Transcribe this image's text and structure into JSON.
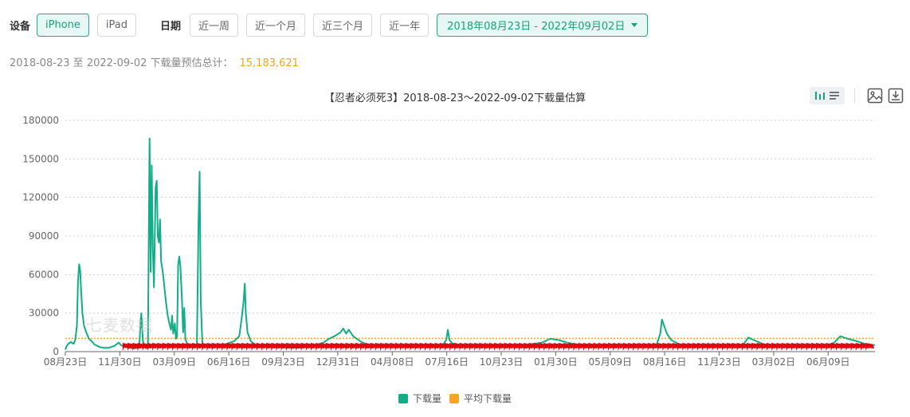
{
  "filters": {
    "device_label": "设备",
    "devices": [
      "iPhone",
      "iPad"
    ],
    "active_device": "iPhone",
    "date_label": "日期",
    "quick_ranges": [
      "近一周",
      "近一个月",
      "近三个月",
      "近一年"
    ],
    "date_range": "2018年08月23日 - 2022年09月02日"
  },
  "summary": {
    "text": "2018-08-23 至 2022-09-02 下载量预估总计：",
    "total": "15,183,621"
  },
  "watermark": "七麦数据",
  "colors": {
    "accent": "#16b08c",
    "series": "#12ad87",
    "average": "#f5a623",
    "marker": "#e8000b",
    "total": "#f5a623"
  },
  "toolbar": {
    "icons": [
      "bar-chart-icon",
      "list-icon",
      "image-export-icon",
      "download-icon"
    ]
  },
  "chart_data": {
    "type": "line",
    "title": "【忍者必须死3】2018-08-23～2022-09-02下载量估算",
    "xlabel": "",
    "ylabel": "",
    "ylim": [
      0,
      180000
    ],
    "yticks": [
      0,
      30000,
      60000,
      90000,
      120000,
      150000,
      180000
    ],
    "ytick_labels": [
      "0",
      "30000",
      "60000",
      "90000",
      "120000",
      "150000",
      "180000"
    ],
    "x_range": [
      "2018-08-23",
      "2022-09-02"
    ],
    "xtick_dates": [
      "2018-08-23",
      "2018-11-30",
      "2019-03-09",
      "2019-06-16",
      "2019-09-23",
      "2019-12-31",
      "2020-04-08",
      "2020-07-16",
      "2020-10-23",
      "2021-01-30",
      "2021-05-09",
      "2021-08-16",
      "2021-11-23",
      "2022-03-02",
      "2022-06-09"
    ],
    "xtick_labels": [
      "08月23日",
      "11月30日",
      "03月09日",
      "06月16日",
      "09月23日",
      "12月31日",
      "04月08日",
      "07月16日",
      "10月23日",
      "01月30日",
      "05月09日",
      "08月16日",
      "11月23日",
      "03月02日",
      "06月09日"
    ],
    "grid": true,
    "legend_position": "bottom",
    "series": [
      {
        "name": "下载量",
        "points": [
          [
            "2018-08-23",
            1500
          ],
          [
            "2018-08-25",
            4000
          ],
          [
            "2018-08-28",
            6000
          ],
          [
            "2018-09-02",
            7500
          ],
          [
            "2018-09-07",
            6000
          ],
          [
            "2018-09-10",
            9000
          ],
          [
            "2018-09-13",
            20000
          ],
          [
            "2018-09-15",
            55000
          ],
          [
            "2018-09-17",
            68000
          ],
          [
            "2018-09-19",
            63000
          ],
          [
            "2018-09-21",
            45000
          ],
          [
            "2018-09-23",
            30000
          ],
          [
            "2018-09-26",
            20000
          ],
          [
            "2018-09-30",
            15000
          ],
          [
            "2018-10-05",
            10000
          ],
          [
            "2018-10-10",
            8000
          ],
          [
            "2018-10-15",
            5500
          ],
          [
            "2018-10-20",
            4500
          ],
          [
            "2018-10-25",
            3500
          ],
          [
            "2018-11-01",
            3000
          ],
          [
            "2018-11-10",
            3000
          ],
          [
            "2018-11-20",
            4500
          ],
          [
            "2018-11-28",
            7000
          ],
          [
            "2018-12-02",
            5000
          ],
          [
            "2018-12-10",
            3500
          ],
          [
            "2018-12-18",
            3000
          ],
          [
            "2018-12-26",
            2500
          ],
          [
            "2019-01-04",
            3000
          ],
          [
            "2019-01-08",
            30000
          ],
          [
            "2019-01-11",
            8000
          ],
          [
            "2019-01-14",
            4000
          ],
          [
            "2019-01-17",
            2500
          ],
          [
            "2019-01-20",
            4000
          ],
          [
            "2019-01-23",
            166000
          ],
          [
            "2019-01-25",
            62000
          ],
          [
            "2019-01-27",
            145000
          ],
          [
            "2019-01-29",
            80000
          ],
          [
            "2019-01-31",
            50000
          ],
          [
            "2019-02-03",
            128000
          ],
          [
            "2019-02-05",
            133000
          ],
          [
            "2019-02-07",
            90000
          ],
          [
            "2019-02-09",
            85000
          ],
          [
            "2019-02-11",
            103000
          ],
          [
            "2019-02-13",
            70000
          ],
          [
            "2019-02-16",
            62000
          ],
          [
            "2019-02-19",
            50000
          ],
          [
            "2019-02-22",
            38000
          ],
          [
            "2019-02-25",
            28000
          ],
          [
            "2019-02-28",
            22000
          ],
          [
            "2019-03-03",
            17000
          ],
          [
            "2019-03-05",
            28000
          ],
          [
            "2019-03-07",
            14000
          ],
          [
            "2019-03-10",
            22000
          ],
          [
            "2019-03-12",
            10000
          ],
          [
            "2019-03-14",
            12000
          ],
          [
            "2019-03-16",
            68000
          ],
          [
            "2019-03-18",
            74000
          ],
          [
            "2019-03-20",
            66000
          ],
          [
            "2019-03-23",
            40000
          ],
          [
            "2019-03-25",
            15000
          ],
          [
            "2019-03-27",
            34000
          ],
          [
            "2019-03-29",
            10000
          ],
          [
            "2019-04-02",
            5000
          ],
          [
            "2019-04-08",
            4000
          ],
          [
            "2019-04-14",
            3500
          ],
          [
            "2019-04-19",
            5000
          ],
          [
            "2019-04-22",
            100000
          ],
          [
            "2019-04-24",
            140000
          ],
          [
            "2019-04-26",
            40000
          ],
          [
            "2019-04-29",
            6000
          ],
          [
            "2019-05-05",
            4000
          ],
          [
            "2019-05-15",
            3500
          ],
          [
            "2019-05-25",
            4500
          ],
          [
            "2019-06-05",
            5000
          ],
          [
            "2019-06-15",
            6500
          ],
          [
            "2019-06-25",
            8000
          ],
          [
            "2019-07-05",
            12000
          ],
          [
            "2019-07-10",
            28000
          ],
          [
            "2019-07-13",
            40000
          ],
          [
            "2019-07-15",
            53000
          ],
          [
            "2019-07-17",
            30000
          ],
          [
            "2019-07-20",
            15000
          ],
          [
            "2019-07-26",
            8000
          ],
          [
            "2019-08-05",
            5000
          ],
          [
            "2019-08-20",
            4000
          ],
          [
            "2019-09-05",
            3500
          ],
          [
            "2019-09-20",
            3500
          ],
          [
            "2019-10-05",
            3000
          ],
          [
            "2019-10-20",
            3000
          ],
          [
            "2019-11-05",
            4000
          ],
          [
            "2019-11-20",
            5000
          ],
          [
            "2019-12-05",
            7000
          ],
          [
            "2019-12-15",
            10000
          ],
          [
            "2019-12-25",
            12000
          ],
          [
            "2020-01-05",
            15000
          ],
          [
            "2020-01-10",
            18000
          ],
          [
            "2020-01-15",
            14000
          ],
          [
            "2020-01-20",
            17000
          ],
          [
            "2020-01-28",
            12000
          ],
          [
            "2020-02-10",
            8000
          ],
          [
            "2020-02-25",
            5000
          ],
          [
            "2020-03-15",
            4000
          ],
          [
            "2020-04-05",
            5000
          ],
          [
            "2020-04-15",
            4000
          ],
          [
            "2020-05-05",
            3500
          ],
          [
            "2020-05-25",
            4000
          ],
          [
            "2020-06-15",
            4500
          ],
          [
            "2020-07-01",
            5000
          ],
          [
            "2020-07-10",
            6000
          ],
          [
            "2020-07-15",
            9000
          ],
          [
            "2020-07-18",
            17000
          ],
          [
            "2020-07-21",
            9000
          ],
          [
            "2020-07-26",
            6500
          ],
          [
            "2020-08-10",
            5000
          ],
          [
            "2020-09-01",
            4000
          ],
          [
            "2020-09-25",
            4000
          ],
          [
            "2020-10-20",
            4500
          ],
          [
            "2020-11-15",
            5000
          ],
          [
            "2020-12-10",
            5500
          ],
          [
            "2021-01-05",
            7000
          ],
          [
            "2021-01-20",
            10000
          ],
          [
            "2021-02-05",
            9000
          ],
          [
            "2021-02-20",
            7000
          ],
          [
            "2021-03-10",
            5500
          ],
          [
            "2021-04-01",
            4500
          ],
          [
            "2021-04-25",
            4000
          ],
          [
            "2021-05-20",
            4000
          ],
          [
            "2021-06-15",
            3500
          ],
          [
            "2021-07-10",
            4000
          ],
          [
            "2021-08-01",
            5000
          ],
          [
            "2021-08-08",
            14000
          ],
          [
            "2021-08-11",
            25000
          ],
          [
            "2021-08-15",
            20000
          ],
          [
            "2021-08-20",
            14000
          ],
          [
            "2021-08-28",
            9000
          ],
          [
            "2021-09-10",
            6000
          ],
          [
            "2021-10-01",
            4500
          ],
          [
            "2021-10-25",
            4000
          ],
          [
            "2021-11-20",
            3500
          ],
          [
            "2021-12-15",
            4000
          ],
          [
            "2022-01-05",
            5000
          ],
          [
            "2022-01-15",
            11000
          ],
          [
            "2022-01-25",
            9000
          ],
          [
            "2022-02-10",
            6000
          ],
          [
            "2022-03-01",
            4500
          ],
          [
            "2022-03-25",
            4000
          ],
          [
            "2022-04-20",
            3500
          ],
          [
            "2022-05-15",
            4000
          ],
          [
            "2022-06-05",
            4500
          ],
          [
            "2022-06-20",
            7000
          ],
          [
            "2022-07-01",
            12000
          ],
          [
            "2022-07-15",
            10000
          ],
          [
            "2022-08-01",
            8000
          ],
          [
            "2022-08-15",
            6000
          ],
          [
            "2022-09-02",
            5000
          ]
        ]
      },
      {
        "name": "平均下载量",
        "values": [
          10285
        ]
      }
    ]
  }
}
